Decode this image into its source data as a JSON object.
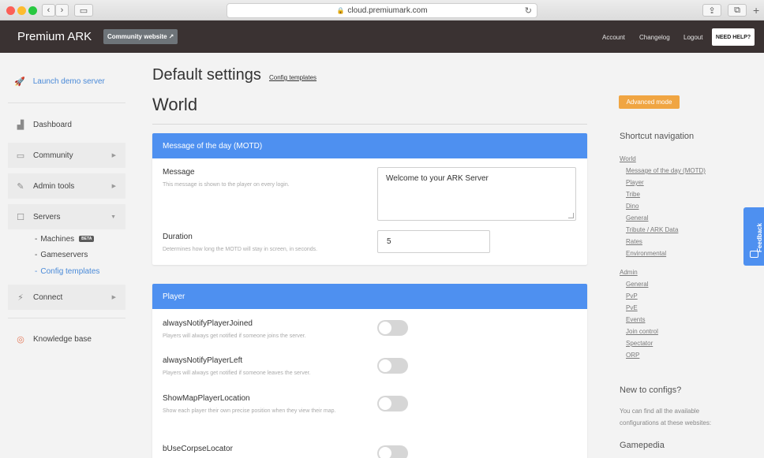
{
  "browser": {
    "url": "cloud.premiumark.com"
  },
  "header": {
    "brand": "Premium ARK",
    "community_button": "Community website",
    "links": [
      "Account",
      "Changelog",
      "Logout"
    ],
    "help_button": "NEED HELP?"
  },
  "sidebar": {
    "launch": "Launch demo server",
    "items": {
      "dashboard": "Dashboard",
      "community": "Community",
      "admin_tools": "Admin tools",
      "servers": "Servers",
      "connect": "Connect",
      "knowledge": "Knowledge base"
    },
    "servers_sub": {
      "machines": "Machines",
      "machines_badge": "BETA",
      "gameservers": "Gameservers",
      "config_templates": "Config templates"
    }
  },
  "main": {
    "title": "Default settings",
    "config_link": "Config templates",
    "section": "World",
    "motd": {
      "heading": "Message of the day (MOTD)",
      "message_label": "Message",
      "message_hint": "This message is shown to the player on every login.",
      "message_value": "Welcome to your ARK Server",
      "duration_label": "Duration",
      "duration_hint": "Determines how long the MOTD will stay in screen, in seconds.",
      "duration_value": "5"
    },
    "player": {
      "heading": "Player",
      "settings": [
        {
          "label": "alwaysNotifyPlayerJoined",
          "hint": "Players will always get notified if someone joins the server.",
          "enabled": false
        },
        {
          "label": "alwaysNotifyPlayerLeft",
          "hint": "Players will always get notified if someone leaves the server.",
          "enabled": false
        },
        {
          "label": "ShowMapPlayerLocation",
          "hint": "Show each player their own precise position when they view their map.",
          "enabled": false
        },
        {
          "label": "bUseCorpseLocator",
          "hint": "",
          "enabled": false
        }
      ]
    }
  },
  "right": {
    "advanced_button": "Advanced mode",
    "shortcut_heading": "Shortcut navigation",
    "world": "World",
    "world_links": [
      "Message of the day (MOTD)",
      "Player",
      "Tribe",
      "Dino",
      "General",
      "Tribute / ARK Data",
      "Rates",
      "Environmental"
    ],
    "admin": "Admin",
    "admin_links": [
      "General",
      "PvP",
      "PvE",
      "Events",
      "Join control",
      "Spectator",
      "ORP"
    ],
    "new_heading": "New to configs?",
    "new_text": "You can find all the available configurations at these websites:",
    "gamepedia": "Gamepedia"
  },
  "feedback_label": "Feedback"
}
